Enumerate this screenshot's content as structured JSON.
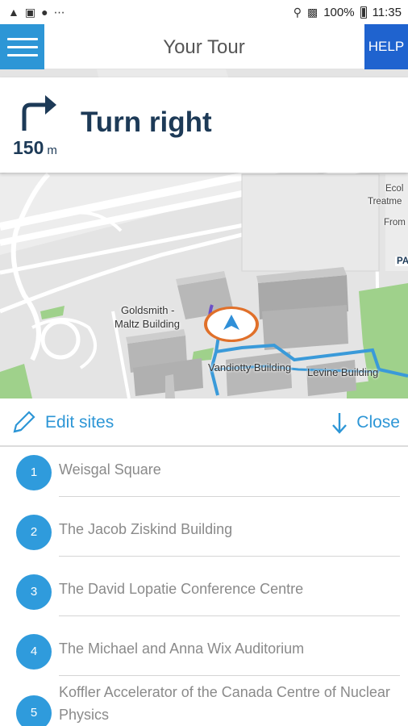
{
  "status_bar": {
    "battery": "100%",
    "time": "11:35",
    "left_icons": [
      "navigation-icon",
      "image-icon",
      "sync-icon",
      "more-icon"
    ],
    "right_icons": [
      "location-icon",
      "signal-icon",
      "battery-icon"
    ]
  },
  "app_bar": {
    "title": "Your Tour",
    "help_label": "HELP"
  },
  "navigation": {
    "instruction": "Turn right",
    "distance_value": "150",
    "distance_unit": "m",
    "icon": "turn-right-arrow-icon"
  },
  "map": {
    "labels": {
      "goldsmith": "Goldsmith -",
      "maltz": "Maltz Building",
      "vandiotty": "Vandiotty Building",
      "levine": "Levine Building",
      "ecol": "Ecol",
      "treatme": "Treatme",
      "from": "From",
      "pa": "PA"
    }
  },
  "sheet": {
    "edit_label": "Edit sites",
    "close_label": "Close",
    "sites": [
      {
        "number": "1",
        "name": "Weisgal Square"
      },
      {
        "number": "2",
        "name": "The Jacob Ziskind Building"
      },
      {
        "number": "3",
        "name": "The David Lopatie Conference Centre"
      },
      {
        "number": "4",
        "name": "The Michael and Anna Wix Auditorium"
      },
      {
        "number": "5",
        "name": "Koffler Accelerator of the Canada Centre of Nuclear Physics"
      }
    ]
  },
  "colors": {
    "primary_blue": "#2d96d6",
    "help_blue": "#1f63cf",
    "route_blue": "#3a9ad9",
    "marker_orange": "#e0702a",
    "instruction_navy": "#1d3a57"
  }
}
